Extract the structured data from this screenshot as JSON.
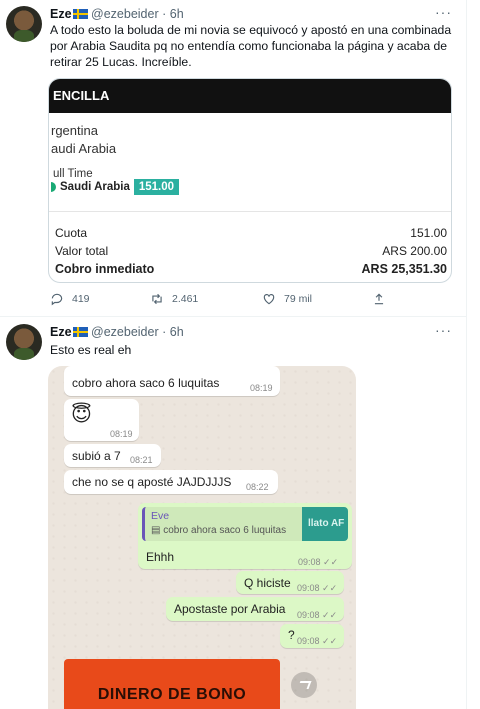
{
  "tweet1": {
    "name": "Eze",
    "handle": "@ezebeider",
    "time": "· 6h",
    "more": "···",
    "text": "A todo esto la boluda de mi novia se equivocó y apostó en una combinada por Arabia Saudita pq no entendía como funcionaba la página y acaba de retirar 25 Lucas. Increíble.",
    "card": {
      "header": "ENCILLA",
      "team1": "rgentina",
      "team2": "audi Arabia",
      "market": "ull Time",
      "selection": "Saudi Arabia",
      "selection_odds": "151.00",
      "rows": [
        {
          "label": "Cuota",
          "value": "151.00"
        },
        {
          "label": "Valor total",
          "value": "ARS 200.00"
        },
        {
          "label": "Cobro inmediato",
          "value": "ARS 25,351.30"
        }
      ]
    },
    "actions": {
      "replies": "419",
      "retweets": "2.461",
      "likes": "79 mil"
    }
  },
  "tweet2": {
    "name": "Eze",
    "handle": "@ezebeider",
    "time": "· 6h",
    "more": "···",
    "text": "Esto es real eh",
    "chat": {
      "messages": [
        {
          "text": "cobro ahora saco 6 luquitas",
          "time": "08:19"
        },
        {
          "text": "😇",
          "time": "08:19"
        },
        {
          "text": "subió a 7",
          "time": "08:21"
        },
        {
          "text": "che no se q aposté JAJDJJJS",
          "time": "08:22"
        }
      ],
      "quote": {
        "name": "Eve",
        "text": "▤ cobro ahora saco 6 luquitas",
        "thumb": "llato AF"
      },
      "replies": [
        {
          "text": "Ehhh",
          "time": "09:08 ✓✓"
        },
        {
          "text": "Q hiciste",
          "time": "09:08 ✓✓"
        },
        {
          "text": "Apostaste por Arabia",
          "time": "09:08 ✓✓"
        },
        {
          "text": "?",
          "time": "09:08 ✓✓"
        }
      ],
      "image_label": "DINERO DE BONO"
    }
  }
}
